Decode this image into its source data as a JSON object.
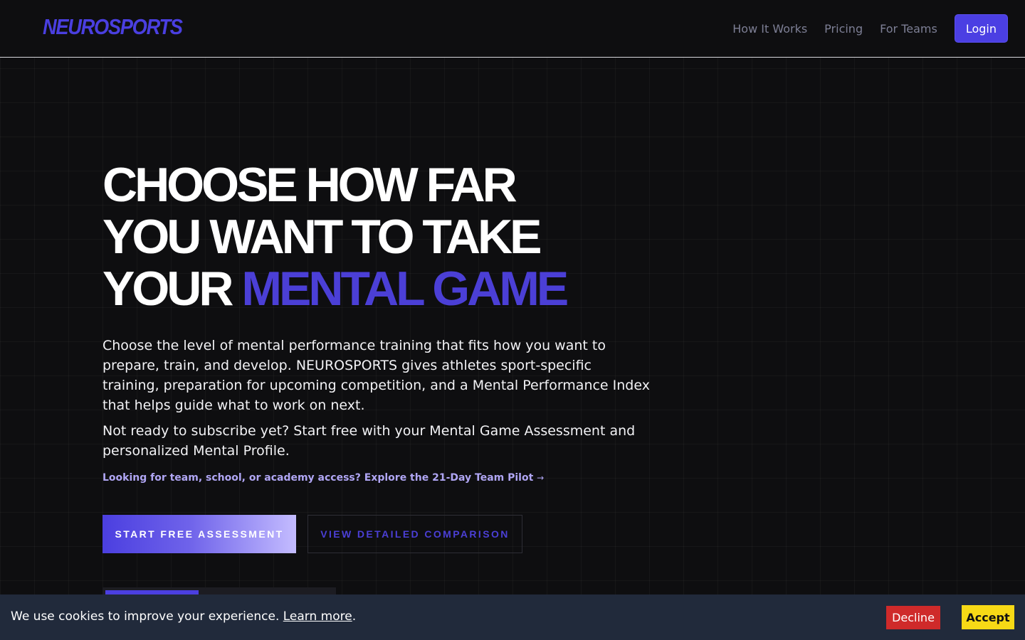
{
  "header": {
    "logo": "NEUROSPORTS",
    "nav": [
      {
        "label": "How It Works"
      },
      {
        "label": "Pricing"
      },
      {
        "label": "For Teams"
      }
    ],
    "login_label": "Login"
  },
  "hero": {
    "title_line1": "CHOOSE HOW FAR",
    "title_line2": "YOU WANT TO TAKE",
    "title_line3_prefix": "YOUR ",
    "title_line3_accent": "MENTAL GAME",
    "paragraph1": "Choose the level of mental performance training that fits how you want to prepare, train, and develop. NEUROSPORTS gives athletes sport-specific training, preparation for upcoming competition, and a Mental Performance Index that helps guide what to work on next.",
    "paragraph2": "Not ready to subscribe yet? Start free with your Mental Game Assessment and personalized Mental Profile.",
    "team_link": "Looking for team, school, or academy access? Explore the 21-Day Team Pilot",
    "team_link_arrow": "→",
    "primary_cta": "START FREE ASSESSMENT",
    "secondary_cta": "VIEW DETAILED COMPARISON"
  },
  "cookie": {
    "text": "We use cookies to improve your experience. ",
    "learn_more": "Learn more",
    "period": ".",
    "decline": "Decline",
    "accept": "Accept"
  },
  "colors": {
    "accent": "#4b3fe0",
    "background": "#0e0e10",
    "cookie_bg": "#212a3b",
    "decline": "#cf2a2a",
    "accept": "#f7d916"
  }
}
